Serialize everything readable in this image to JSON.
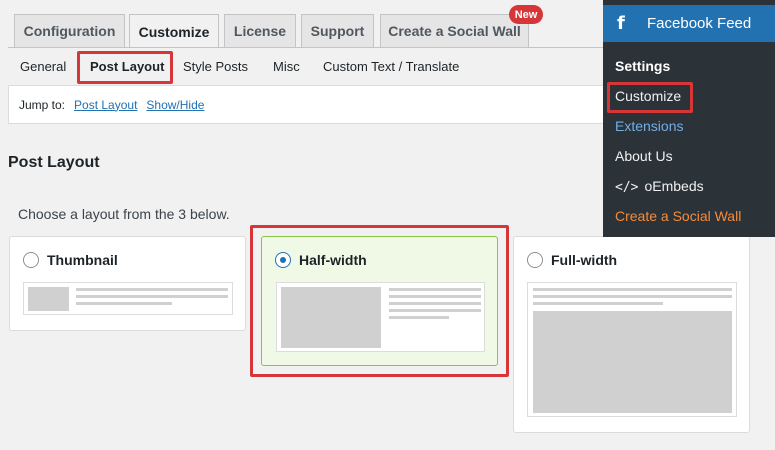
{
  "tabs": [
    {
      "label": "Configuration"
    },
    {
      "label": "Customize"
    },
    {
      "label": "License"
    },
    {
      "label": "Support"
    },
    {
      "label": "Create a Social Wall"
    }
  ],
  "new_badge": "New",
  "subtabs": [
    {
      "label": "General"
    },
    {
      "label": "Post Layout"
    },
    {
      "label": "Style Posts"
    },
    {
      "label": "Misc"
    },
    {
      "label": "Custom Text / Translate"
    }
  ],
  "jump": {
    "label": "Jump to:",
    "links": [
      "Post Layout",
      "Show/Hide"
    ]
  },
  "section_title": "Post Layout",
  "description": "Choose a layout from the 3 below.",
  "layouts": [
    {
      "label": "Thumbnail",
      "checked": false
    },
    {
      "label": "Half-width",
      "checked": true
    },
    {
      "label": "Full-width",
      "checked": false
    }
  ],
  "sidebar": {
    "header": "Facebook Feed",
    "header_icon": "facebook-icon",
    "items": [
      {
        "label": "Settings"
      },
      {
        "label": "Customize"
      },
      {
        "label": "Extensions"
      },
      {
        "label": "About Us"
      },
      {
        "label": "oEmbeds",
        "icon": "code-icon"
      },
      {
        "label": "Create a Social Wall"
      }
    ]
  },
  "colors": {
    "accent": "#2271b1",
    "highlight": "#d63638",
    "selected_border": "#8bc34a",
    "orange": "#f58b3a"
  }
}
